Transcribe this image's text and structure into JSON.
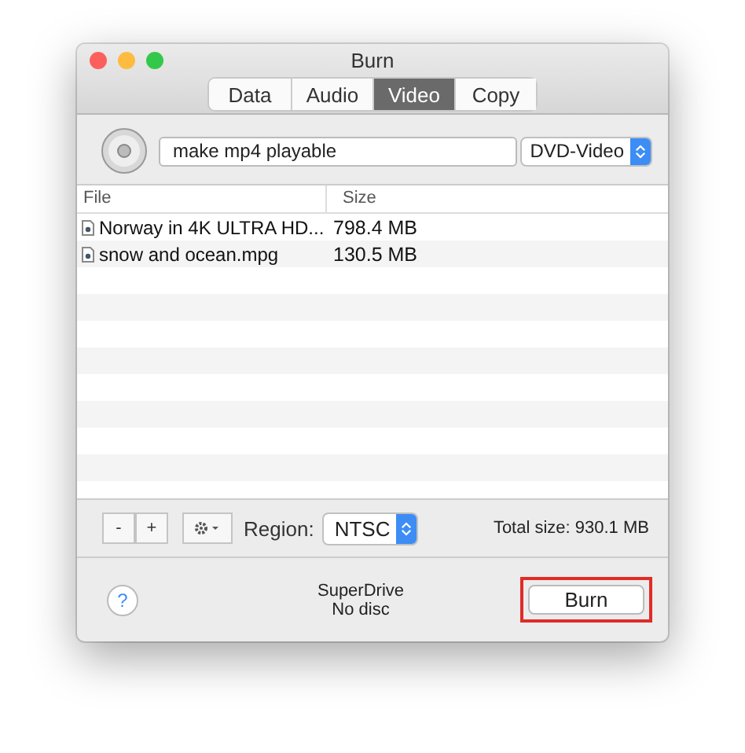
{
  "window": {
    "title": "Burn"
  },
  "tabs": [
    {
      "label": "Data",
      "selected": false
    },
    {
      "label": "Audio",
      "selected": false
    },
    {
      "label": "Video",
      "selected": true
    },
    {
      "label": "Copy",
      "selected": false
    }
  ],
  "disc_name": {
    "value": "make mp4 playable"
  },
  "format": {
    "value": "DVD-Video"
  },
  "table": {
    "columns": [
      "File",
      "Size"
    ],
    "rows": [
      {
        "file": "Norway in 4K ULTRA HD...",
        "size": "798.4 MB"
      },
      {
        "file": "snow and ocean.mpg",
        "size": "130.5 MB"
      }
    ]
  },
  "toolbar": {
    "remove": "-",
    "add": "+",
    "region_label": "Region:",
    "region": "NTSC",
    "total": "Total size: 930.1 MB"
  },
  "footer": {
    "help": "?",
    "drive": "SuperDrive",
    "status": "No disc",
    "burn": {
      "label": "Burn",
      "highlighted": true
    }
  }
}
